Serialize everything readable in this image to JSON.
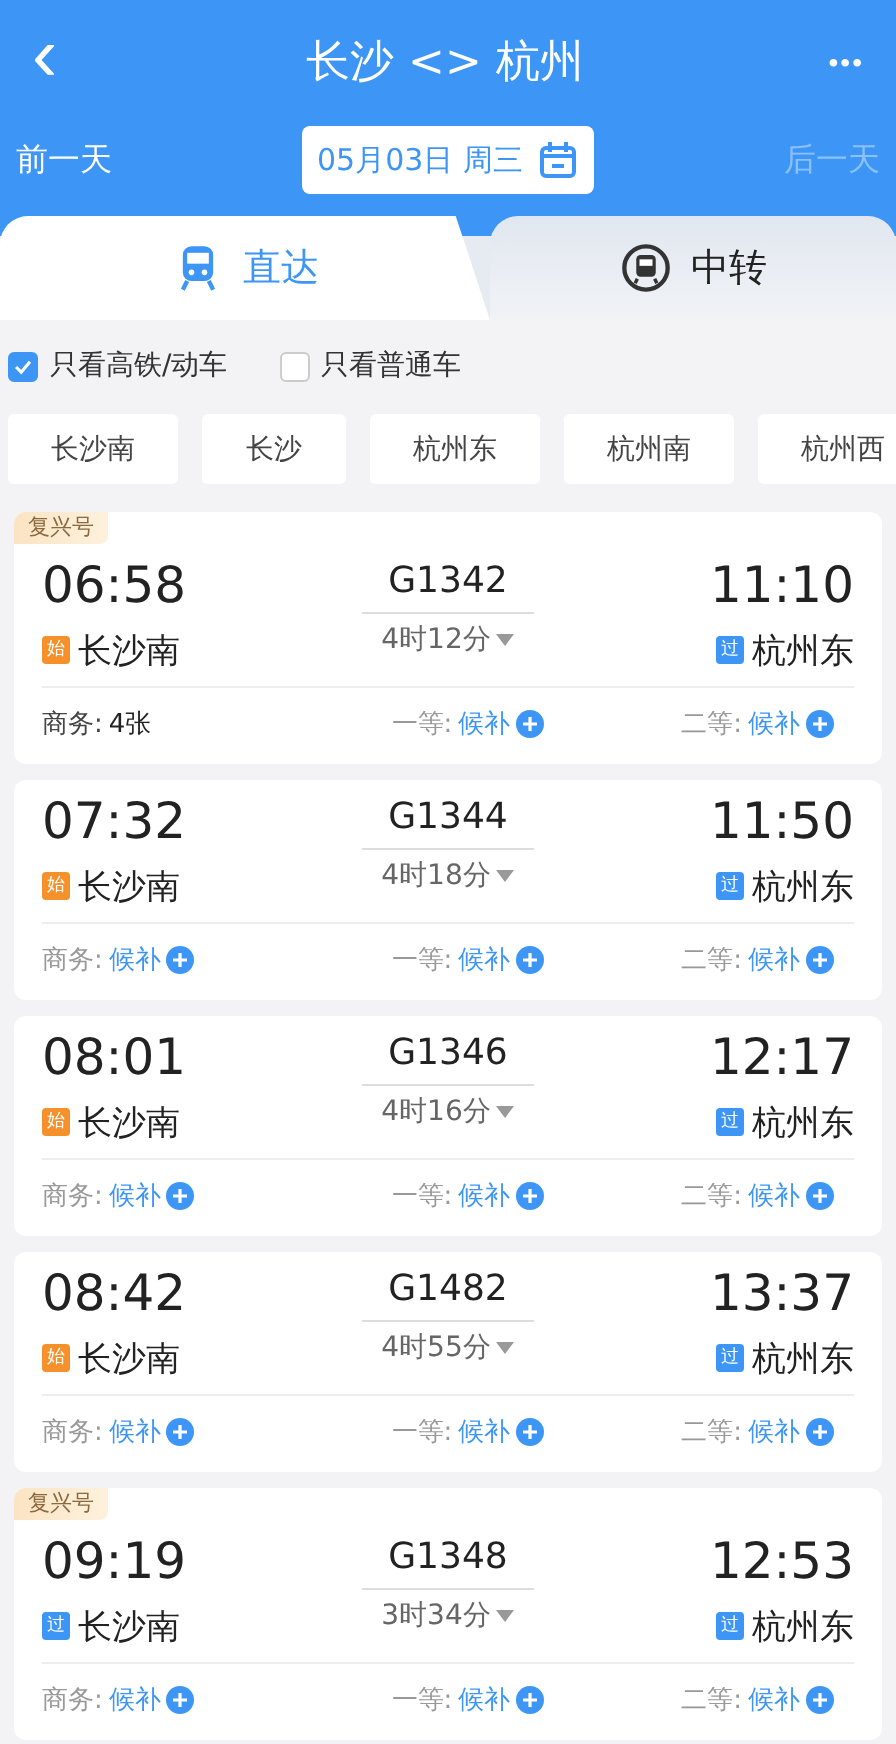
{
  "header": {
    "back_icon": "‹",
    "title": "长沙 <> 杭州",
    "more": "•••"
  },
  "date_bar": {
    "prev": {
      "label": "前一天",
      "disabled": false
    },
    "date": "05月03日 周三",
    "next": {
      "label": "后一天",
      "disabled": true
    }
  },
  "tabs": [
    {
      "label": "直达",
      "selected": true,
      "kind": "direct"
    },
    {
      "label": "中转",
      "selected": false,
      "kind": "transfer"
    }
  ],
  "filters": [
    {
      "label": "只看高铁/动车",
      "checked": true
    },
    {
      "label": "只看普通车",
      "checked": false
    }
  ],
  "stations": [
    "长沙南",
    "长沙",
    "杭州东",
    "杭州南",
    "杭州西"
  ],
  "trains": [
    {
      "badge": "复兴号",
      "depart": "06:58",
      "from_tag": {
        "text": "始",
        "kind": "start"
      },
      "from": "长沙南",
      "number": "G1342",
      "duration": "4时12分",
      "arrive": "11:10",
      "to_tag": {
        "text": "过",
        "kind": "pass"
      },
      "to": "杭州东",
      "seats": [
        {
          "label": "商务:",
          "value": "4张",
          "kind": "count"
        },
        {
          "label": "一等:",
          "value": "候补",
          "kind": "waitlist"
        },
        {
          "label": "二等:",
          "value": "候补",
          "kind": "waitlist"
        }
      ]
    },
    {
      "depart": "07:32",
      "from_tag": {
        "text": "始",
        "kind": "start"
      },
      "from": "长沙南",
      "number": "G1344",
      "duration": "4时18分",
      "arrive": "11:50",
      "to_tag": {
        "text": "过",
        "kind": "pass"
      },
      "to": "杭州东",
      "seats": [
        {
          "label": "商务:",
          "value": "候补",
          "kind": "waitlist"
        },
        {
          "label": "一等:",
          "value": "候补",
          "kind": "waitlist"
        },
        {
          "label": "二等:",
          "value": "候补",
          "kind": "waitlist"
        }
      ]
    },
    {
      "depart": "08:01",
      "from_tag": {
        "text": "始",
        "kind": "start"
      },
      "from": "长沙南",
      "number": "G1346",
      "duration": "4时16分",
      "arrive": "12:17",
      "to_tag": {
        "text": "过",
        "kind": "pass"
      },
      "to": "杭州东",
      "seats": [
        {
          "label": "商务:",
          "value": "候补",
          "kind": "waitlist"
        },
        {
          "label": "一等:",
          "value": "候补",
          "kind": "waitlist"
        },
        {
          "label": "二等:",
          "value": "候补",
          "kind": "waitlist"
        }
      ]
    },
    {
      "depart": "08:42",
      "from_tag": {
        "text": "始",
        "kind": "start"
      },
      "from": "长沙南",
      "number": "G1482",
      "duration": "4时55分",
      "arrive": "13:37",
      "to_tag": {
        "text": "过",
        "kind": "pass"
      },
      "to": "杭州东",
      "seats": [
        {
          "label": "商务:",
          "value": "候补",
          "kind": "waitlist"
        },
        {
          "label": "一等:",
          "value": "候补",
          "kind": "waitlist"
        },
        {
          "label": "二等:",
          "value": "候补",
          "kind": "waitlist"
        }
      ]
    },
    {
      "badge": "复兴号",
      "depart": "09:19",
      "from_tag": {
        "text": "过",
        "kind": "pass"
      },
      "from": "长沙南",
      "number": "G1348",
      "duration": "3时34分",
      "arrive": "12:53",
      "to_tag": {
        "text": "过",
        "kind": "pass"
      },
      "to": "杭州东",
      "seats": [
        {
          "label": "商务:",
          "value": "候补",
          "kind": "waitlist"
        },
        {
          "label": "一等:",
          "value": "候补",
          "kind": "waitlist"
        },
        {
          "label": "二等:",
          "value": "候补",
          "kind": "waitlist"
        }
      ]
    }
  ]
}
